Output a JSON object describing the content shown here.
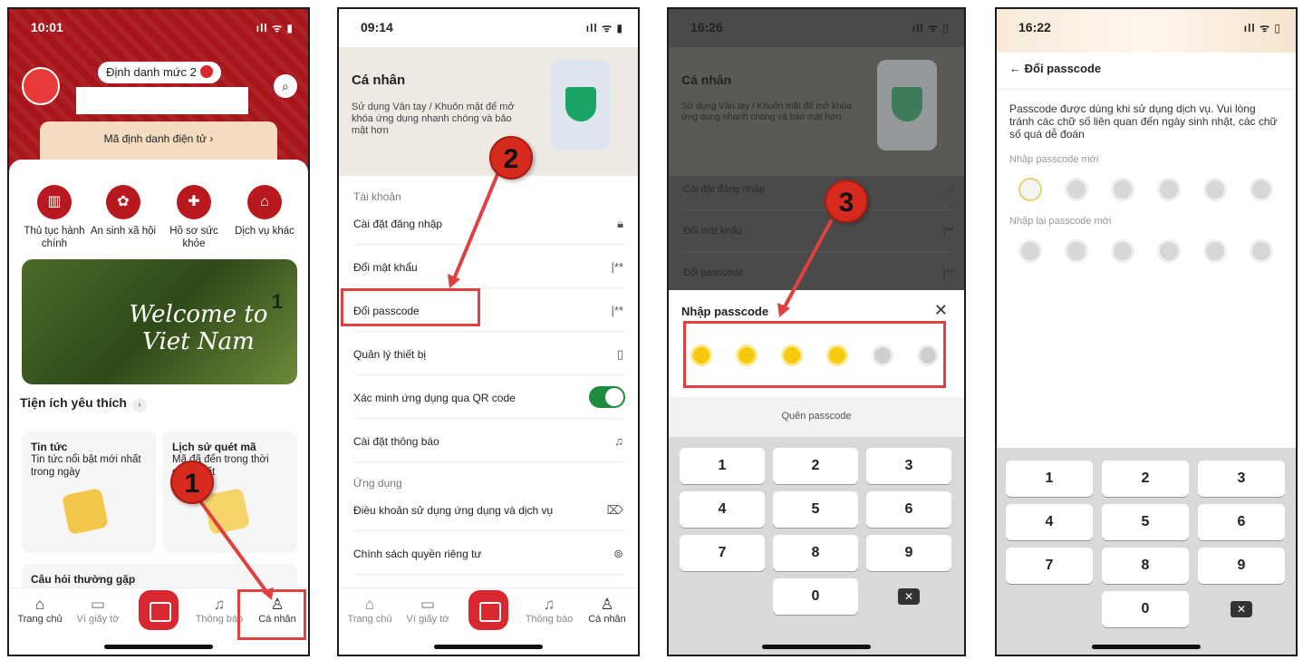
{
  "screen1": {
    "time": "10:01",
    "status_icons": "ıll ᯤ ▮",
    "id_level": "Định danh mức 2",
    "e_id": "Mã định danh điện tử ›",
    "services": [
      "Thủ tục hành chính",
      "An sinh xã hội",
      "Hồ sơ sức khỏe",
      "Dịch vụ khác"
    ],
    "banner_text": "Welcome to Viet Nam",
    "banner_page": "1",
    "favorites_title": "Tiện ích yêu thích",
    "cards": [
      {
        "title": "Tin tức",
        "text": "Tin tức nổi bật mới nhất trong ngày"
      },
      {
        "title": "Lịch sử quét mã",
        "text": "Mã đã đến trong thời gian nhất"
      }
    ],
    "faq_title": "Câu hỏi thường gặp",
    "tabs": [
      "Trang chủ",
      "Ví giấy tờ",
      "Thông báo",
      "Cá nhân"
    ],
    "step": "1"
  },
  "screen2": {
    "time": "09:14",
    "status_icons": "ıll ᯤ ▮",
    "title": "Cá nhân",
    "subtitle": "Sử dụng Vân tay / Khuôn mặt để mở khóa ứng dụng nhanh chóng và bảo mật hơn",
    "section_account": "Tài khoản",
    "rows": [
      "Cài đặt đăng nhập",
      "Đổi mật khẩu",
      "Đổi passcode",
      "Quản lý thiết bị",
      "Xác minh ứng dụng qua QR code",
      "Cài đặt thông báo"
    ],
    "section_app": "Ứng dụng",
    "app_rows": [
      "Điều khoản sử dụng ứng dụng và dịch vụ",
      "Chính sách quyền riêng tư"
    ],
    "masked": "|**",
    "qr_toggle_on": true,
    "tabs": [
      "Trang chủ",
      "Ví giấy tờ",
      "Thông báo",
      "Cá nhân"
    ],
    "step": "2"
  },
  "screen3": {
    "time": "16:26",
    "status_icons": "ıll ᯤ ▯",
    "title": "Cá nhân",
    "subtitle": "Sử dụng Vân tay / Khuôn mặt để mở khóa ứng dụng nhanh chóng và bảo mật hơn",
    "rows": [
      "Cài đặt đăng nhập",
      "Đổi mật khẩu",
      "Đổi passcode"
    ],
    "masked": "|**",
    "modal_title": "Nhập passcode",
    "filled_digits": 4,
    "total_digits": 6,
    "forgot": "Quên passcode",
    "keys": [
      "1",
      "2",
      "3",
      "4",
      "5",
      "6",
      "7",
      "8",
      "9",
      "0"
    ],
    "delete_glyph": "✕",
    "step": "3"
  },
  "screen4": {
    "time": "16:22",
    "status_icons": "ıll ᯤ ▯",
    "back_title": "← Đổi passcode",
    "description": "Passcode được dùng khi sử dụng dịch vụ. Vui lòng tránh các chữ số liên quan đến ngày sinh nhật, các chữ số quá dễ đoán",
    "new_label": "Nhập passcode mới",
    "confirm_label": "Nhập lại passcode mới",
    "keys": [
      "1",
      "2",
      "3",
      "4",
      "5",
      "6",
      "7",
      "8",
      "9",
      "0"
    ],
    "delete_glyph": "✕"
  },
  "colors": {
    "brand_red": "#b8191f",
    "accent_yellow": "#f6c90e",
    "highlight": "#e04040",
    "toggle_green": "#1e8c3c"
  }
}
